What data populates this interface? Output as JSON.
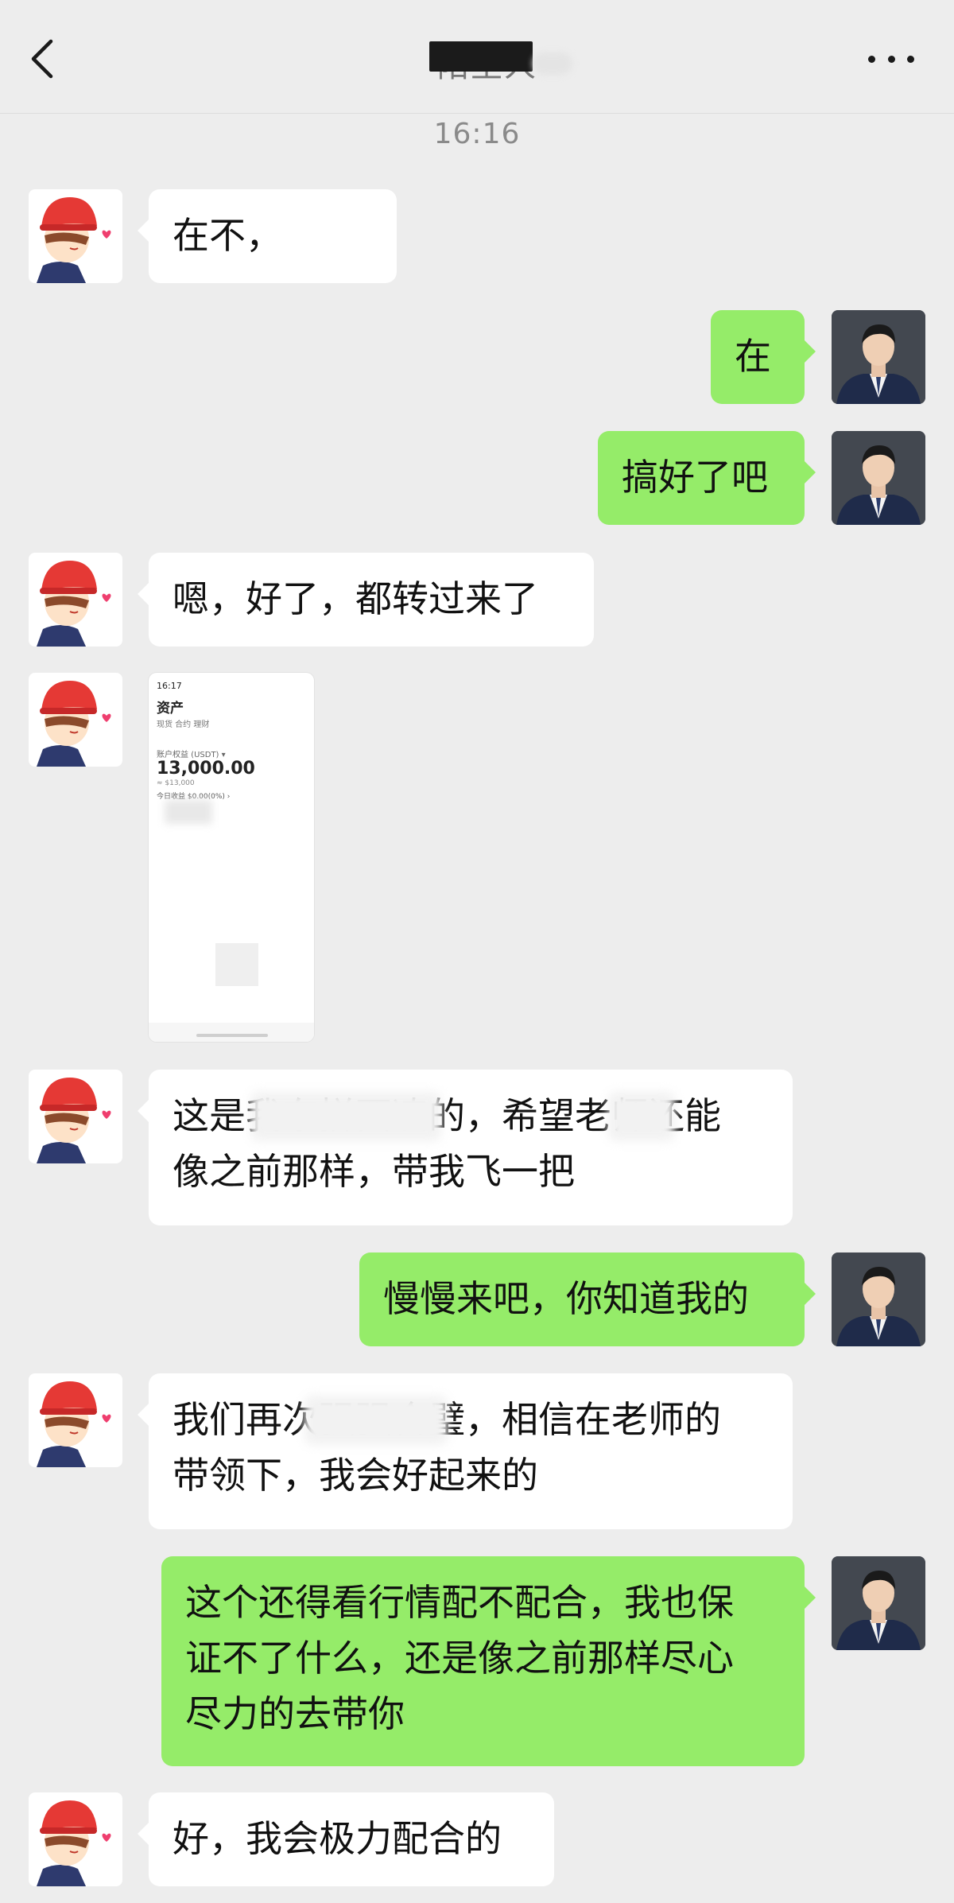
{
  "header": {
    "title": "陌生人",
    "back_icon": "chevron-left-icon",
    "more_icon": "more-dots-icon"
  },
  "timestamp": "16:16",
  "messages": [
    {
      "side": "in",
      "text": "在不，"
    },
    {
      "side": "out",
      "text": "在"
    },
    {
      "side": "out",
      "text": "搞好了吧"
    },
    {
      "side": "in",
      "text": "嗯，好了，都转过来了"
    },
    {
      "side": "in",
      "type": "image",
      "image": {
        "time": "16:17",
        "title": "资产",
        "tabs": "现货     合约     理财",
        "label": "账户权益 (USDT) ▾",
        "amount": "13,000.00",
        "sub": "≈ $13,000",
        "pnl": "今日收益 $0.00(0%) ›"
      }
    },
    {
      "side": "in",
      "lines": [
        "这是我东拼西凑的，希望老师还能",
        "像之前那样，带我飞一把"
      ]
    },
    {
      "side": "out",
      "text": "慢慢来吧，你知道我的"
    },
    {
      "side": "in",
      "lines": [
        "我们再次强强合璧，相信在老师的",
        "带领下，我会好起来的"
      ]
    },
    {
      "side": "out",
      "lines": [
        "这个还得看行情配不配合，我也保",
        "证不了什么，还是像之前那样尽心",
        "尽力的去带你"
      ]
    },
    {
      "side": "in",
      "text": "好，我会极力配合的"
    }
  ],
  "colors": {
    "background": "#ededed",
    "incoming_bubble": "#ffffff",
    "outgoing_bubble": "#95ec69",
    "text": "#111111",
    "timestamp": "#8a8a8a"
  }
}
